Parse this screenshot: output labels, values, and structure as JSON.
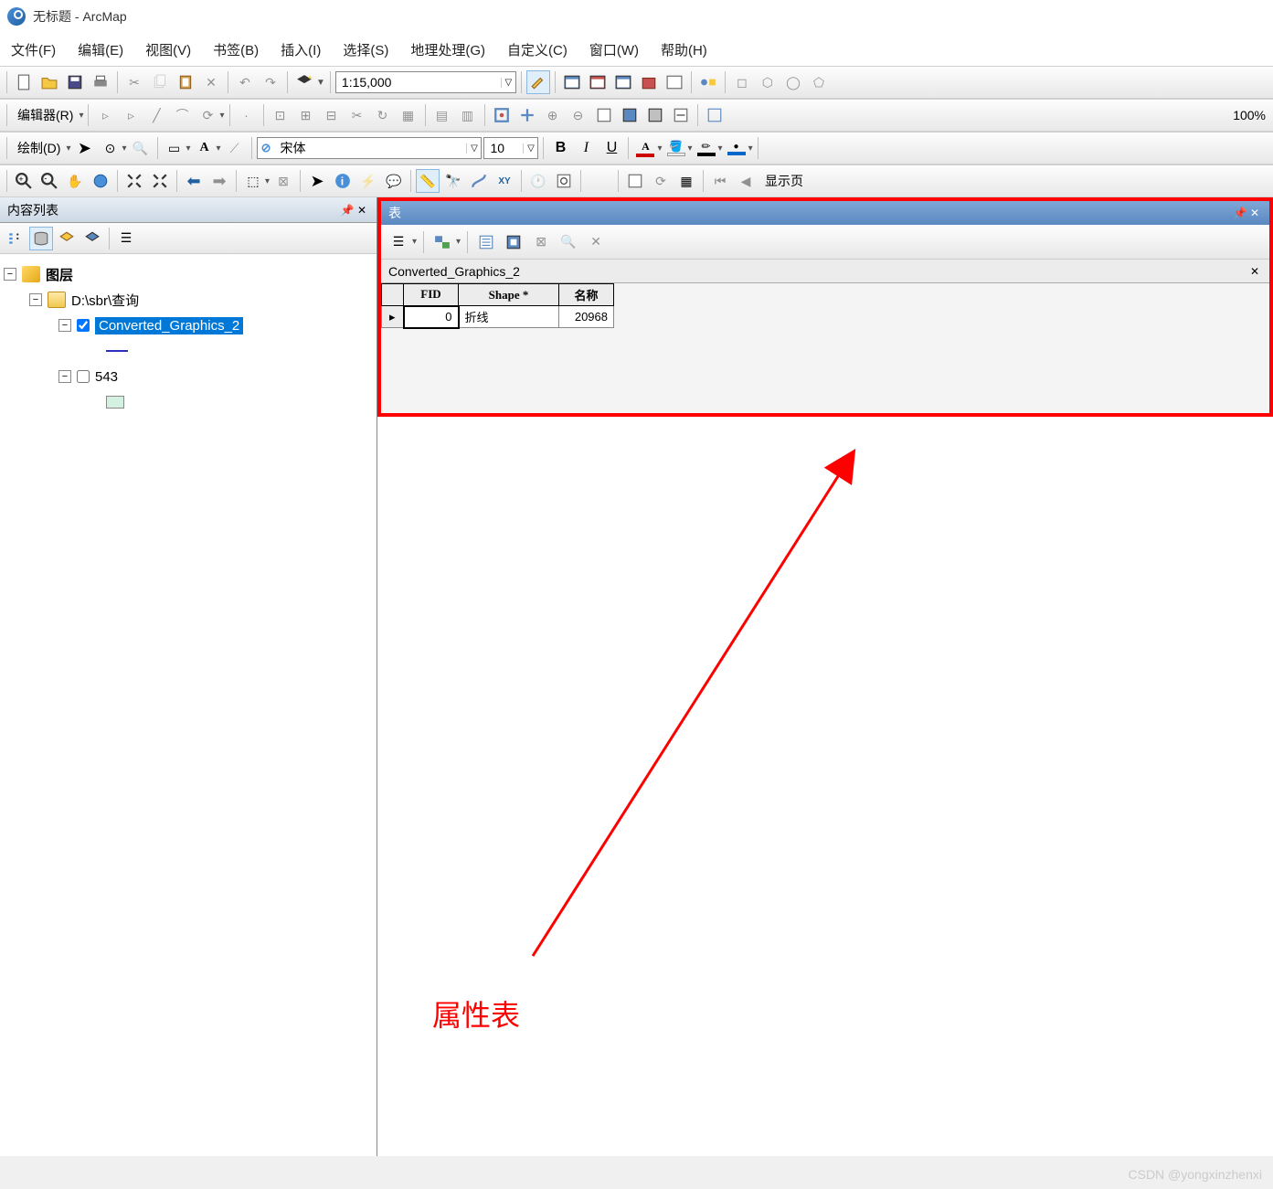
{
  "window": {
    "title": "无标题 - ArcMap"
  },
  "menu": {
    "file": "文件(F)",
    "edit": "编辑(E)",
    "view": "视图(V)",
    "bookmark": "书签(B)",
    "insert": "插入(I)",
    "select": "选择(S)",
    "geoproc": "地理处理(G)",
    "custom": "自定义(C)",
    "window": "窗口(W)",
    "help": "帮助(H)"
  },
  "toolbar1": {
    "scale": "1:15,000"
  },
  "toolbar2": {
    "editor": "编辑器(R)",
    "zoom": "100%"
  },
  "toolbar3": {
    "draw": "绘制(D)",
    "font": "宋体",
    "size": "10"
  },
  "toolbar4": {
    "showpage": "显示页"
  },
  "toc": {
    "title": "内容列表",
    "root": "图层",
    "path": "D:\\sbr\\查询",
    "layer1": "Converted_Graphics_2",
    "layer2": "543"
  },
  "table": {
    "title": "表",
    "name": "Converted_Graphics_2",
    "columns": {
      "fid": "FID",
      "shape": "Shape *",
      "name": "名称"
    },
    "row": {
      "fid": "0",
      "shape": "折线",
      "name": "20968"
    }
  },
  "annotation": {
    "label": "属性表"
  },
  "watermark": "CSDN @yongxinzhenxi"
}
